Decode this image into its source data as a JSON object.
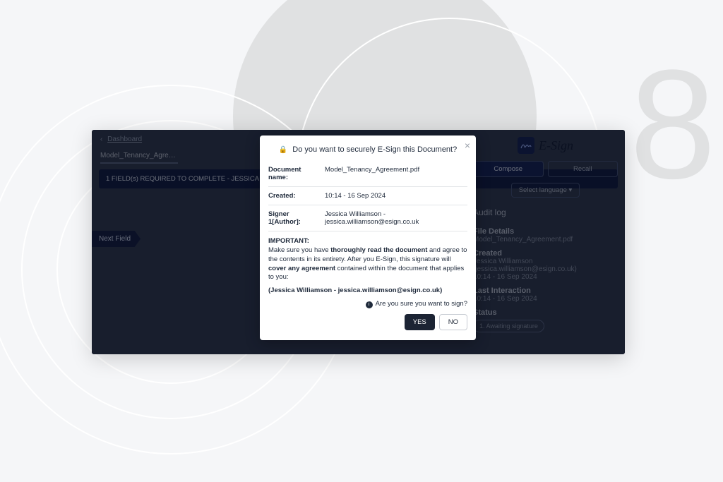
{
  "breadcrumb": {
    "back_label": "Dashboard"
  },
  "tab": {
    "label": "Model_Tenancy_Agreem…"
  },
  "banner": {
    "text": "1 FIELD(s) REQUIRED TO COMPLETE - JESSICA WILLIAMSON"
  },
  "next_field": {
    "label": "Next Field"
  },
  "brand": {
    "name": "E-Sign"
  },
  "buttons": {
    "compose": "Compose",
    "recall": "Recall"
  },
  "language": {
    "label": "Select language "
  },
  "audit": {
    "title": "Audit log",
    "file_details_label": "File Details",
    "file_details_value": "Model_Tenancy_Agreement.pdf",
    "created_label": "Created",
    "created_value_line1": "Jessica Williamson (jessica.williamson@esign.co.uk)",
    "created_value_line2": "10:14 - 16 Sep 2024",
    "last_interaction_label": "Last Interaction",
    "last_interaction_value": "10:14 - 16 Sep 2024",
    "status_label": "Status",
    "status_chip": "1. Awaiting signature"
  },
  "modal": {
    "title": "Do you want to securely E-Sign this Document?",
    "rows": {
      "doc_name_label": "Document name:",
      "doc_name_value": "Model_Tenancy_Agreement.pdf",
      "created_label": "Created:",
      "created_value": "10:14 - 16 Sep 2024",
      "signer_label": "Signer 1[Author]:",
      "signer_value": "Jessica Williamson - jessica.williamson@esign.co.uk"
    },
    "important_label": "IMPORTANT:",
    "important_text_1": "Make sure you have ",
    "important_bold_1": "thoroughly read the document",
    "important_text_2": " and agree to the contents in its entirety. After you E-Sign, this signature will ",
    "important_bold_2": "cover any agreement",
    "important_text_3": " contained within the document that applies to you:",
    "author_line": "(Jessica Williamson - jessica.williamson@esign.co.uk)",
    "confirm_question": "Are you sure you want to sign?",
    "yes": "YES",
    "no": "NO"
  }
}
